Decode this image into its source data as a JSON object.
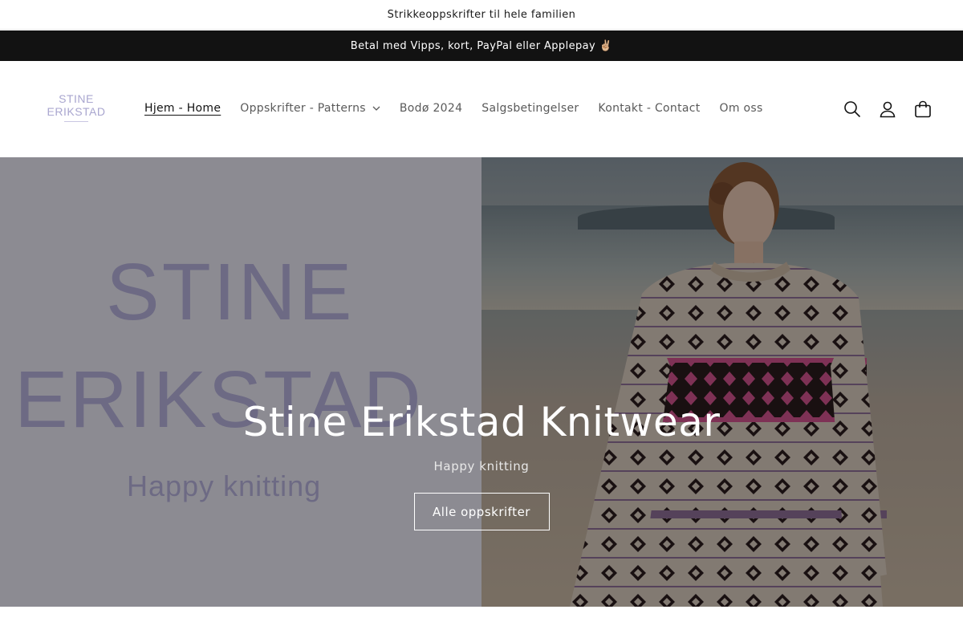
{
  "announcement": {
    "top": "Strikkeoppskrifter til hele familien",
    "payment": "Betal med Vipps, kort, PayPal eller Applepay ✌🏼"
  },
  "logo": {
    "line1": "STINE",
    "line2": "ERIKSTAD"
  },
  "nav": {
    "items": [
      {
        "label": "Hjem - Home",
        "active": true
      },
      {
        "label": "Oppskrifter - Patterns",
        "has_dropdown": true
      },
      {
        "label": "Bodø 2024"
      },
      {
        "label": "Salgsbetingelser"
      },
      {
        "label": "Kontakt - Contact"
      },
      {
        "label": "Om oss"
      }
    ]
  },
  "header_icons": [
    "search-icon",
    "account-icon",
    "cart-icon"
  ],
  "hero": {
    "image_text": {
      "line1": "STINE",
      "line2": "ERIKSTAD",
      "line3": "Happy knitting"
    },
    "title": "Stine Erikstad Knitwear",
    "subtitle": "Happy knitting",
    "button": "Alle oppskrifter"
  },
  "colors": {
    "dark_bar": "#121212",
    "logo": "#a9a6cf",
    "accent_pink": "#c2457f"
  }
}
